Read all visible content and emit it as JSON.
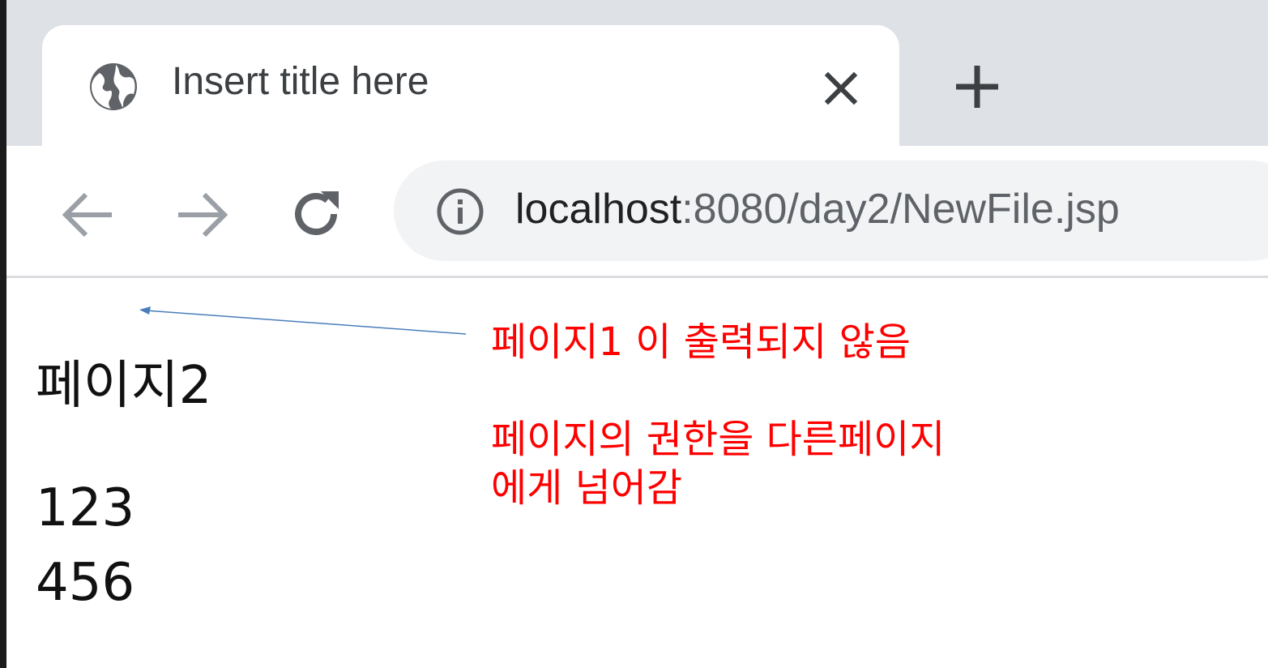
{
  "tab": {
    "title": "Insert title here"
  },
  "address_bar": {
    "host": "localhost",
    "rest": ":8080/day2/NewFile.jsp"
  },
  "content": {
    "heading": "페이지2",
    "line1": "123",
    "line2": "456"
  },
  "annotations": {
    "note1": "페이지1 이 출력되지 않음",
    "note2_line1": "페이지의 권한을 다른페이지",
    "note2_line2": "에게 넘어감"
  },
  "colors": {
    "annotation": "#ff0000",
    "arrow": "#4a7ebb",
    "tabstrip": "#dee1e6",
    "omnibox": "#f1f3f4"
  },
  "icons": {
    "favicon": "globe-icon",
    "close": "close-icon",
    "new_tab": "plus-icon",
    "back": "arrow-left-icon",
    "forward": "arrow-right-icon",
    "reload": "reload-icon",
    "site_info": "info-icon"
  }
}
